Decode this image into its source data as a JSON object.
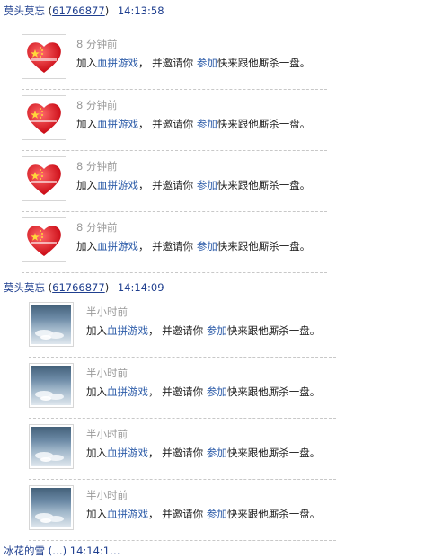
{
  "groups": [
    {
      "sender": "莫头莫忘",
      "uid": "61766877",
      "time": "14:13:58",
      "items": [
        {
          "avatar": "heart-china-icon",
          "timestamp": "8 分钟前",
          "msg_pre": "加入",
          "game_link": "血拼游戏",
          "msg_mid": "， 并邀请你 ",
          "join_link": "参加",
          "msg_post": "快来跟他厮杀一盘。"
        },
        {
          "avatar": "heart-china-icon",
          "timestamp": "8 分钟前",
          "msg_pre": "加入",
          "game_link": "血拼游戏",
          "msg_mid": "， 并邀请你 ",
          "join_link": "参加",
          "msg_post": "快来跟他厮杀一盘。"
        },
        {
          "avatar": "heart-china-icon",
          "timestamp": "8 分钟前",
          "msg_pre": "加入",
          "game_link": "血拼游戏",
          "msg_mid": "， 并邀请你 ",
          "join_link": "参加",
          "msg_post": "快来跟他厮杀一盘。"
        },
        {
          "avatar": "heart-china-icon",
          "timestamp": "8 分钟前",
          "msg_pre": "加入",
          "game_link": "血拼游戏",
          "msg_mid": "， 并邀请你 ",
          "join_link": "参加",
          "msg_post": "快来跟他厮杀一盘。"
        }
      ]
    },
    {
      "sender": "莫头莫忘",
      "uid": "61766877",
      "time": "14:14:09",
      "items": [
        {
          "avatar": "sky-photo-icon",
          "timestamp": "半小时前",
          "msg_pre": "加入",
          "game_link": "血拼游戏",
          "msg_mid": "， 并邀请你 ",
          "join_link": "参加",
          "msg_post": "快来跟他厮杀一盘。"
        },
        {
          "avatar": "sky-photo-icon",
          "timestamp": "半小时前",
          "msg_pre": "加入",
          "game_link": "血拼游戏",
          "msg_mid": "， 并邀请你 ",
          "join_link": "参加",
          "msg_post": "快来跟他厮杀一盘。"
        },
        {
          "avatar": "sky-photo-icon",
          "timestamp": "半小时前",
          "msg_pre": "加入",
          "game_link": "血拼游戏",
          "msg_mid": "， 并邀请你 ",
          "join_link": "参加",
          "msg_post": "快来跟他厮杀一盘。"
        },
        {
          "avatar": "sky-photo-icon",
          "timestamp": "半小时前",
          "msg_pre": "加入",
          "game_link": "血拼游戏",
          "msg_mid": "， 并邀请你 ",
          "join_link": "参加",
          "msg_post": "快来跟他厮杀一盘。"
        }
      ]
    }
  ],
  "next_group_partial": "冰花的雪 (…) 14:14:1…",
  "colors": {
    "link": "#2a5aa8",
    "header": "#1f3f8f",
    "timestamp": "#9a9a9a",
    "separator": "#c8c8c8",
    "heart": "#e0141e"
  }
}
